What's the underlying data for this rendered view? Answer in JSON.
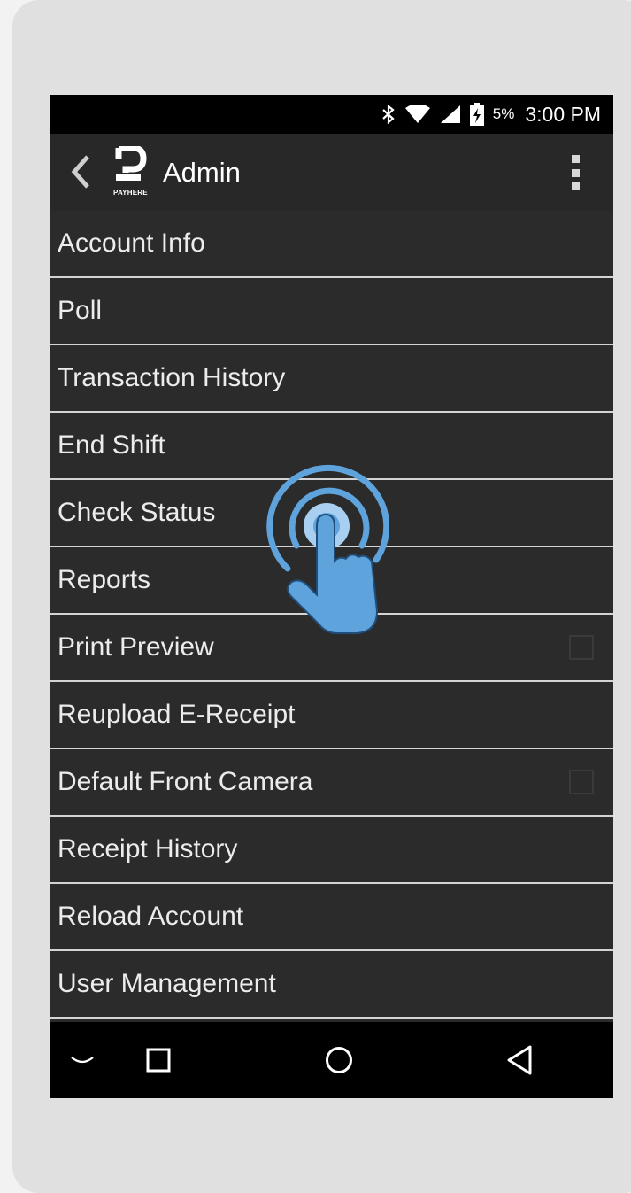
{
  "status_bar": {
    "battery_percent": "5%",
    "time": "3:00 PM",
    "icons": [
      "bluetooth-icon",
      "wifi-icon",
      "signal-icon",
      "battery-charging-icon"
    ]
  },
  "action_bar": {
    "title": "Admin",
    "logo_text": "PAYHERE",
    "back_icon": "chevron-left-icon",
    "overflow_icon": "more-vertical-icon"
  },
  "menu": {
    "items": [
      {
        "label": "Account Info"
      },
      {
        "label": "Poll"
      },
      {
        "label": "Transaction History"
      },
      {
        "label": "End Shift"
      },
      {
        "label": "Check Status"
      },
      {
        "label": "Reports"
      },
      {
        "label": "Print Preview",
        "checkbox": false
      },
      {
        "label": "Reupload E-Receipt"
      },
      {
        "label": "Default Front Camera",
        "checkbox": false
      },
      {
        "label": "Receipt History"
      },
      {
        "label": "Reload Account"
      },
      {
        "label": "User Management"
      }
    ]
  },
  "nav_bar": {
    "icons": [
      "keyboard-hide-icon",
      "recents-icon",
      "home-icon",
      "back-triangle-icon"
    ]
  },
  "overlay": {
    "icon": "tap-gesture-icon"
  },
  "colors": {
    "screen_bg": "#2b2b2b",
    "divider": "#d4d4d4",
    "text": "#ececec",
    "tap_accent": "#5ea3dc"
  }
}
